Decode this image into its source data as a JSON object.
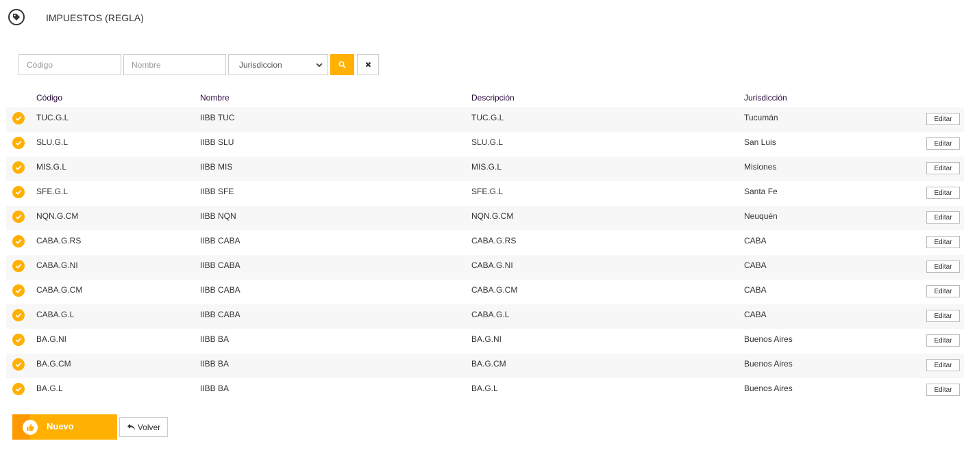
{
  "header": {
    "title": "IMPUESTOS (REGLA)",
    "icon": "tag-icon"
  },
  "filters": {
    "codigo_placeholder": "Código",
    "nombre_placeholder": "Nombre",
    "jurisdiccion_selected": "Jurisdiccion",
    "search_icon": "search-icon",
    "clear_icon": "close-icon"
  },
  "table": {
    "columns": [
      "Código",
      "Nombre",
      "Descripción",
      "Jurisdicción"
    ],
    "edit_label": "Editar",
    "rows": [
      {
        "codigo": "TUC.G.L",
        "nombre": "IIBB TUC",
        "descripcion": "TUC.G.L",
        "jurisdiccion": "Tucumán"
      },
      {
        "codigo": "SLU.G.L",
        "nombre": "IIBB SLU",
        "descripcion": "SLU.G.L",
        "jurisdiccion": "San Luis"
      },
      {
        "codigo": "MIS.G.L",
        "nombre": "IIBB MIS",
        "descripcion": "MIS.G.L",
        "jurisdiccion": "Misiones"
      },
      {
        "codigo": "SFE.G.L",
        "nombre": "IIBB SFE",
        "descripcion": "SFE.G.L",
        "jurisdiccion": "Santa Fe"
      },
      {
        "codigo": "NQN.G.CM",
        "nombre": "IIBB NQN",
        "descripcion": "NQN.G.CM",
        "jurisdiccion": "Neuquén"
      },
      {
        "codigo": "CABA.G.RS",
        "nombre": "IIBB CABA",
        "descripcion": "CABA.G.RS",
        "jurisdiccion": "CABA"
      },
      {
        "codigo": "CABA.G.NI",
        "nombre": "IIBB CABA",
        "descripcion": "CABA.G.NI",
        "jurisdiccion": "CABA"
      },
      {
        "codigo": "CABA.G.CM",
        "nombre": "IIBB CABA",
        "descripcion": "CABA.G.CM",
        "jurisdiccion": "CABA"
      },
      {
        "codigo": "CABA.G.L",
        "nombre": "IIBB CABA",
        "descripcion": "CABA.G.L",
        "jurisdiccion": "CABA"
      },
      {
        "codigo": "BA.G.NI",
        "nombre": "IIBB BA",
        "descripcion": "BA.G.NI",
        "jurisdiccion": "Buenos Aires"
      },
      {
        "codigo": "BA.G.CM",
        "nombre": "IIBB BA",
        "descripcion": "BA.G.CM",
        "jurisdiccion": "Buenos Aires"
      },
      {
        "codigo": "BA.G.L",
        "nombre": "IIBB BA",
        "descripcion": "BA.G.L",
        "jurisdiccion": "Buenos Aires"
      }
    ]
  },
  "actions": {
    "nuevo_label": "Nuevo",
    "volver_label": "Volver"
  },
  "colors": {
    "accent": "#ffb000",
    "accent_dark": "#ff9900",
    "row_alt": "#f7f7f7",
    "header_text": "#2a0a3a"
  }
}
